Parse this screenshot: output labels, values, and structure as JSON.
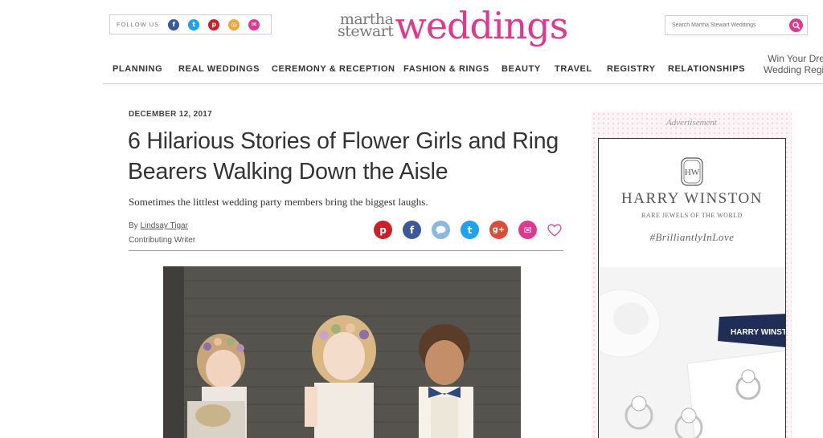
{
  "header": {
    "follow_label": "FOLLOW US",
    "social": [
      {
        "name": "facebook",
        "glyph": "f",
        "color": "#3b5998"
      },
      {
        "name": "twitter",
        "glyph": "t",
        "color": "#1da1f2"
      },
      {
        "name": "pinterest",
        "glyph": "p",
        "color": "#cb2027"
      },
      {
        "name": "instagram",
        "glyph": "◎",
        "color": "#f2a33a"
      },
      {
        "name": "email",
        "glyph": "✉",
        "color": "#e0388d"
      }
    ],
    "logo_line1": "martha",
    "logo_line2": "stewart",
    "logo_main": "weddings",
    "search_placeholder": "Search Martha Stewart Weddings"
  },
  "nav": {
    "items": [
      "PLANNING",
      "REAL WEDDINGS",
      "CEREMONY & RECEPTION",
      "FASHION & RINGS",
      "BEAUTY",
      "TRAVEL",
      "REGISTRY",
      "RELATIONSHIPS"
    ],
    "promo_line1": "Win Your Dre",
    "promo_line2": "Wedding Regis"
  },
  "article": {
    "date": "DECEMBER 12, 2017",
    "title": "6 Hilarious Stories of Flower Girls and Ring Bearers Walking Down the Aisle",
    "dek": "Sometimes the littlest wedding party members bring the biggest laughs.",
    "by_prefix": "By",
    "author": "Lindsay Tigar",
    "author_role": "Contributing Writer"
  },
  "share": [
    {
      "name": "pinterest",
      "glyph": "p",
      "color": "#cb2027"
    },
    {
      "name": "facebook",
      "glyph": "f",
      "color": "#3b5998"
    },
    {
      "name": "comment",
      "glyph": "💬",
      "color": "#8ab8e0"
    },
    {
      "name": "twitter",
      "glyph": "t",
      "color": "#1da1f2"
    },
    {
      "name": "googleplus",
      "glyph": "g+",
      "color": "#dd4b39"
    },
    {
      "name": "email",
      "glyph": "✉",
      "color": "#e0388d"
    }
  ],
  "ad": {
    "label": "Advertisement",
    "monogram": "HW",
    "brand": "HARRY WINSTON",
    "subtitle": "RARE JEWELS OF THE WORLD",
    "hashtag": "#BrilliantlyInLove",
    "box_text": "HARRY WINSTO"
  },
  "colors": {
    "brand_pink": "#e0388d"
  }
}
